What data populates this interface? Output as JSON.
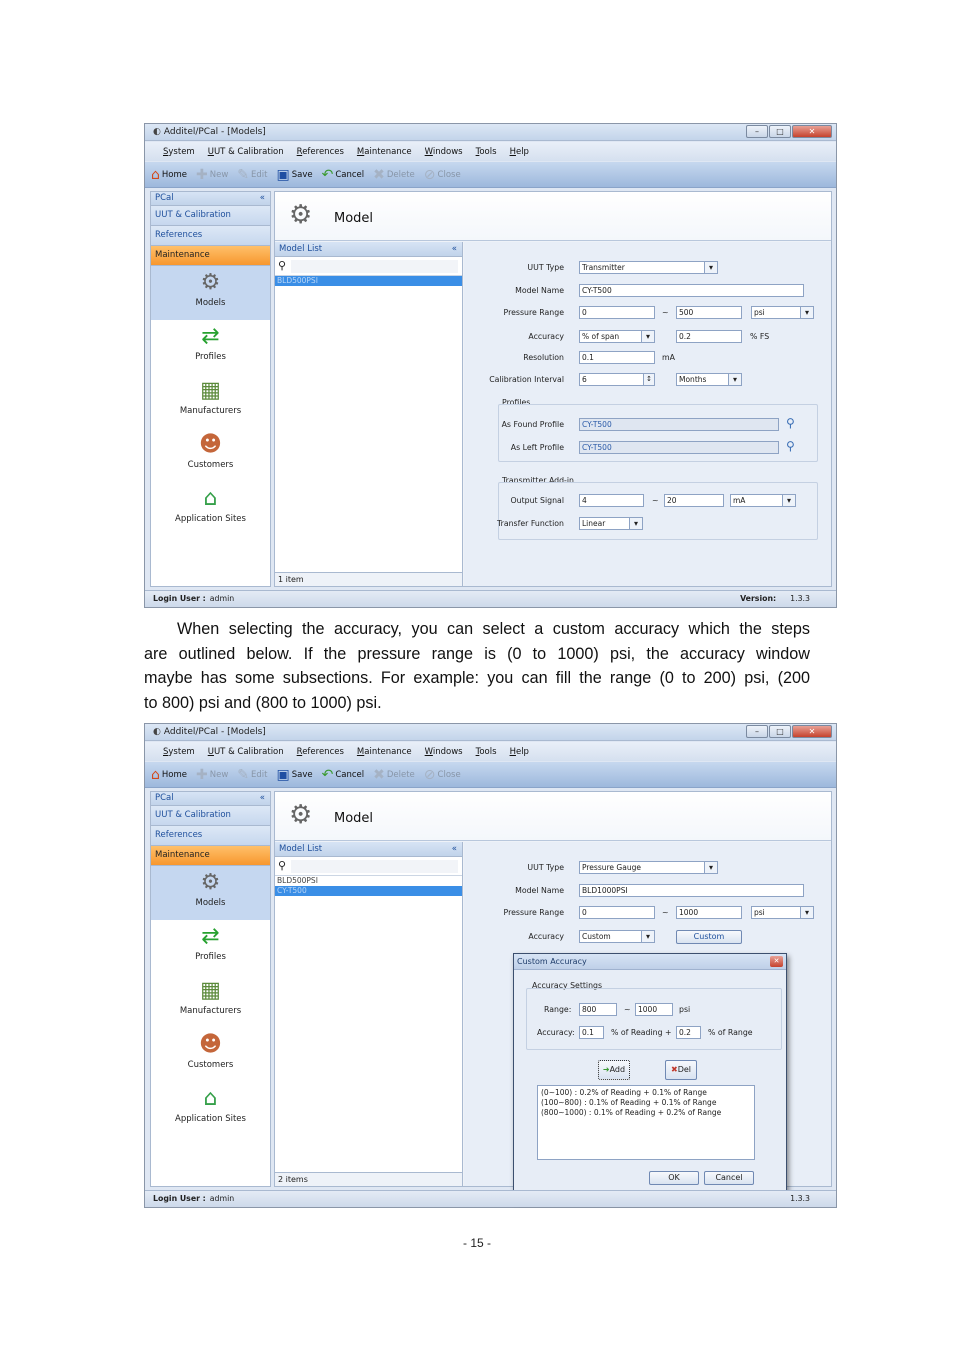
{
  "shot1": {
    "window_title": "Additel/PCal - [Models]",
    "menu": [
      "System",
      "UUT & Calibration",
      "References",
      "Maintenance",
      "Windows",
      "Tools",
      "Help"
    ],
    "toolbar": {
      "home": "Home",
      "new": "New",
      "edit": "Edit",
      "save": "Save",
      "cancel": "Cancel",
      "delete": "Delete",
      "close": "Close"
    },
    "sidebar": {
      "header": "PCal",
      "sections": [
        "UUT & Calibration",
        "References",
        "Maintenance"
      ],
      "items": [
        "Models",
        "Profiles",
        "Manufacturers",
        "Customers",
        "Application Sites"
      ]
    },
    "page_title": "Model",
    "model_list": {
      "header": "Model List",
      "rows": [
        "BLD500PSI"
      ],
      "footer": "1 item"
    },
    "form": {
      "uut_type_label": "UUT Type",
      "uut_type": "Transmitter",
      "model_name_label": "Model Name",
      "model_name": "CY-T500",
      "pressure_range_label": "Pressure Range",
      "range_low": "0",
      "range_sep": "~",
      "range_high": "500",
      "range_unit": "psi",
      "accuracy_label": "Accuracy",
      "accuracy_type": "% of span",
      "accuracy_value": "0.2",
      "accuracy_unit": "% FS",
      "resolution_label": "Resolution",
      "resolution": "0.1",
      "resolution_unit": "mA",
      "cal_interval_label": "Calibration Interval",
      "cal_interval": "6",
      "cal_interval_unit": "Months",
      "profiles_group": "Profiles",
      "as_found_label": "As Found Profile",
      "as_found": "CY-T500",
      "as_left_label": "As Left Profile",
      "as_left": "CY-T500",
      "transmitter_group": "Transmitter Add-in",
      "output_signal_label": "Output Signal",
      "output_low": "4",
      "output_sep": "~",
      "output_high": "20",
      "output_unit": "mA",
      "transfer_label": "Transfer Function",
      "transfer": "Linear"
    },
    "status": {
      "login_label": "Login User :",
      "login_user": "admin",
      "version_label": "Version:",
      "version": "1.3.3"
    }
  },
  "paragraph": [
    "When selecting the accuracy, you can select a custom accuracy which the steps",
    "are outlined below. If the pressure range is (0 to 1000) psi, the accuracy window",
    "maybe has some subsections. For example: you can fill the range (0 to 200) psi, (200",
    "to 800) psi and (800 to 1000) psi."
  ],
  "shot2": {
    "window_title": "Additel/PCal - [Models]",
    "menu": [
      "System",
      "UUT & Calibration",
      "References",
      "Maintenance",
      "Windows",
      "Tools",
      "Help"
    ],
    "toolbar": {
      "home": "Home",
      "new": "New",
      "edit": "Edit",
      "save": "Save",
      "cancel": "Cancel",
      "delete": "Delete",
      "close": "Close"
    },
    "sidebar": {
      "header": "PCal",
      "sections": [
        "UUT & Calibration",
        "References",
        "Maintenance"
      ],
      "items": [
        "Models",
        "Profiles",
        "Manufacturers",
        "Customers",
        "Application Sites"
      ]
    },
    "page_title": "Model",
    "model_list": {
      "header": "Model List",
      "rows": [
        "BLD500PSI",
        "CY-T500"
      ],
      "footer": "2 items"
    },
    "form": {
      "uut_type_label": "UUT Type",
      "uut_type": "Pressure Gauge",
      "model_name_label": "Model Name",
      "model_name": "BLD1000PSI",
      "pressure_range_label": "Pressure Range",
      "range_low": "0",
      "range_sep": "~",
      "range_high": "1000",
      "range_unit": "psi",
      "accuracy_label": "Accuracy",
      "accuracy_type": "Custom",
      "custom_button": "Custom"
    },
    "dialog": {
      "title": "Custom Accuracy",
      "settings_label": "Accuracy Settings",
      "range_label": "Range:",
      "range_low": "800",
      "range_sep": "~",
      "range_high": "1000",
      "range_unit": "psi",
      "accuracy_label": "Accuracy:",
      "reading_value": "0.1",
      "reading_unit": "% of Reading +",
      "range_value": "0.2",
      "range_pct_unit": "% of Range",
      "add_button": "Add",
      "del_button": "Del",
      "results": [
        "(0~100) : 0.2% of Reading + 0.1% of Range",
        "(100~800) : 0.1% of Reading + 0.1% of Range",
        "(800~1000) : 0.1% of Reading + 0.2% of Range"
      ],
      "ok_button": "OK",
      "cancel_button": "Cancel"
    },
    "status": {
      "login_label": "Login User :",
      "login_user": "admin",
      "version": "1.3.3"
    }
  },
  "page_number": "- 15 -"
}
